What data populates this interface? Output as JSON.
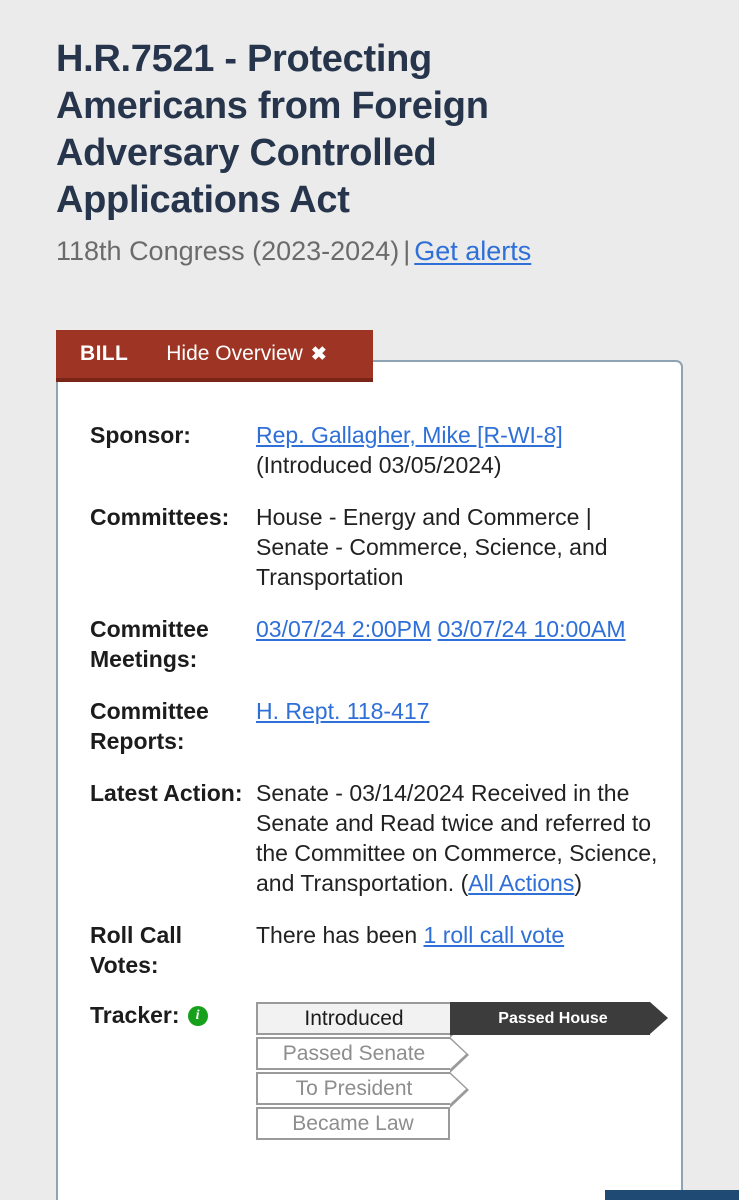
{
  "page": {
    "background_color": "#ebebeb",
    "title": "H.R.7521 - Protecting Americans from Foreign Adversary Controlled Applications Act",
    "congress": "118th Congress (2023-2024)",
    "separator": "|",
    "alerts_link": "Get alerts"
  },
  "colors": {
    "banner_red": "#9e3524",
    "banner_red_dark": "#7a2518",
    "link_blue": "#2e6fd8",
    "title_navy": "#26354b",
    "info_green": "#17a01b",
    "tracker_active": "#3c3c3c",
    "card_border": "#8fa3b2",
    "bottom_bar": "#1f4a73"
  },
  "overview": {
    "banner": {
      "type_label": "BILL",
      "toggle_label": "Hide Overview",
      "close_glyph": "✖"
    },
    "rows": [
      {
        "label": "Sponsor:",
        "link": "Rep. Gallagher, Mike [R-WI-8]",
        "suffix": "(Introduced 03/05/2024)"
      },
      {
        "label": "Committees:",
        "value": "House - Energy and Commerce | Senate - Commerce, Science, and Transportation"
      },
      {
        "label": "Committee Meetings:",
        "link1": "03/07/24 2:00PM",
        "link2": "03/07/24 10:00AM"
      },
      {
        "label": "Committee Reports:",
        "link": "H. Rept. 118-417"
      },
      {
        "label": "Latest Action:",
        "text_before": "Senate - 03/14/2024 Received in the Senate and Read twice and referred to the Committee on Commerce, Science, and Transportation. (",
        "link": "All Actions",
        "text_after": ")"
      },
      {
        "label": "Roll Call Votes:",
        "text_before": "There has been ",
        "link": "1 roll call vote"
      }
    ],
    "tracker": {
      "label": "Tracker:",
      "info_glyph": "i",
      "steps": [
        {
          "label": "Introduced",
          "state": "completed"
        },
        {
          "label": "Passed House",
          "state": "current"
        },
        {
          "label": "Passed Senate",
          "state": "pending"
        },
        {
          "label": "To President",
          "state": "pending"
        },
        {
          "label": "Became Law",
          "state": "pending"
        }
      ]
    }
  }
}
